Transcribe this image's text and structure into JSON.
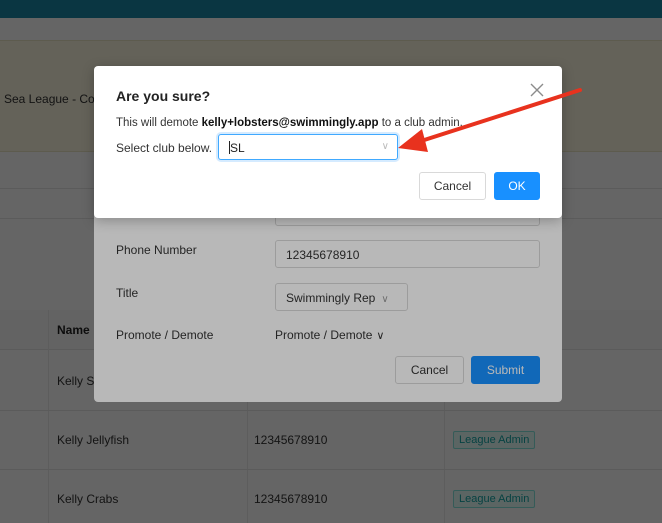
{
  "background": {
    "banner_text": "Sea League - Co",
    "table": {
      "name_header": "Name",
      "rows": [
        {
          "name": "Kelly S",
          "phone": "",
          "role": ""
        },
        {
          "name": "Kelly Jellyfish",
          "phone": "12345678910",
          "role": "League Admin"
        },
        {
          "name": "Kelly Crabs",
          "phone": "12345678910",
          "role": "League Admin"
        }
      ]
    }
  },
  "form_modal": {
    "phone_label": "Phone Number",
    "phone_value": "12345678910",
    "title_label": "Title",
    "title_value": "Swimmingly Rep",
    "promote_label": "Promote / Demote",
    "promote_value": "Promote / Demote",
    "cancel_label": "Cancel",
    "submit_label": "Submit"
  },
  "confirm_dialog": {
    "title": "Are you sure?",
    "message_prefix": "This will demote ",
    "message_email": "kelly+lobsters@swimmingly.app",
    "message_suffix": " to a club admin.",
    "select_label": "Select club below.",
    "select_value": "SL",
    "cancel_label": "Cancel",
    "ok_label": "OK",
    "close_icon": "close-icon"
  },
  "colors": {
    "primary": "#1890ff",
    "topbar": "#1a8aa8",
    "tag_text": "#13a8a8",
    "arrow": "#e8321e"
  }
}
